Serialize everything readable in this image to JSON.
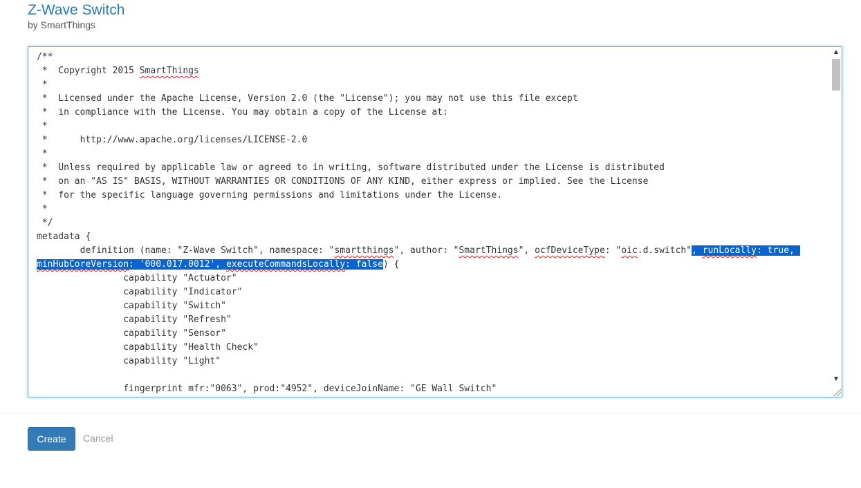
{
  "header": {
    "title": "Z-Wave Switch",
    "byline": "by SmartThings"
  },
  "editor": {
    "lines": [
      [
        {
          "t": "/**"
        }
      ],
      [
        {
          "t": " *  Copyright 2015 "
        },
        {
          "t": "SmartThings",
          "sq": true
        }
      ],
      [
        {
          "t": " *"
        }
      ],
      [
        {
          "t": " *  Licensed under the Apache License, Version 2.0 (the \"License\"); you may not use this file except"
        }
      ],
      [
        {
          "t": " *  in compliance with the License. You may obtain a copy of the License at:"
        }
      ],
      [
        {
          "t": " *"
        }
      ],
      [
        {
          "t": " *      http://www.apache.org/licenses/LICENSE-2.0"
        }
      ],
      [
        {
          "t": " *"
        }
      ],
      [
        {
          "t": " *  Unless required by applicable law or agreed to in writing, software distributed under the License is distributed"
        }
      ],
      [
        {
          "t": " *  on an \"AS IS\" BASIS, WITHOUT WARRANTIES OR CONDITIONS OF ANY KIND, either express or implied. See the License"
        }
      ],
      [
        {
          "t": " *  for the specific language governing permissions and limitations under the License."
        }
      ],
      [
        {
          "t": " *"
        }
      ],
      [
        {
          "t": " */"
        }
      ],
      [
        {
          "t": "metadata {"
        }
      ],
      [
        {
          "t": "        definition (name: \"Z-Wave Switch\", namespace: \""
        },
        {
          "t": "smartthings",
          "sq": true
        },
        {
          "t": "\", author: \""
        },
        {
          "t": "SmartThings",
          "sq": true
        },
        {
          "t": "\", "
        },
        {
          "t": "ocfDeviceType",
          "sq": true
        },
        {
          "t": ": \""
        },
        {
          "t": "oic",
          "sq": true
        },
        {
          "t": ".d.switch\""
        },
        {
          "t": ", ",
          "sel": true
        },
        {
          "t": "runLocally",
          "sel": true,
          "sq": true
        },
        {
          "t": ": true, ",
          "sel": true
        }
      ],
      [
        {
          "t": "minHubCoreVersion",
          "sel": true,
          "sq": true
        },
        {
          "t": ": '000.017.0012', ",
          "sel": true
        },
        {
          "t": "executeCommandsLocally",
          "sel": true,
          "sq": true
        },
        {
          "t": ": false",
          "sel": true
        },
        {
          "t": ") {"
        }
      ],
      [
        {
          "t": "                capability \"Actuator\""
        }
      ],
      [
        {
          "t": "                capability \"Indicator\""
        }
      ],
      [
        {
          "t": "                capability \"Switch\""
        }
      ],
      [
        {
          "t": "                capability \"Refresh\""
        }
      ],
      [
        {
          "t": "                capability \"Sensor\""
        }
      ],
      [
        {
          "t": "                capability \"Health Check\""
        }
      ],
      [
        {
          "t": "                capability \"Light\""
        }
      ],
      [
        {
          "t": ""
        }
      ],
      [
        {
          "t": "                fingerprint mfr:\"0063\", prod:\"4952\", deviceJoinName: \"GE Wall Switch\""
        }
      ]
    ]
  },
  "scrollbar": {
    "up_icon": "▲",
    "down_icon": "▼"
  },
  "actions": {
    "create_label": "Create",
    "cancel_label": "Cancel"
  },
  "colors": {
    "title": "#2a7bc2",
    "selection": "#0a64cf",
    "primary_button": "#337ab7"
  }
}
